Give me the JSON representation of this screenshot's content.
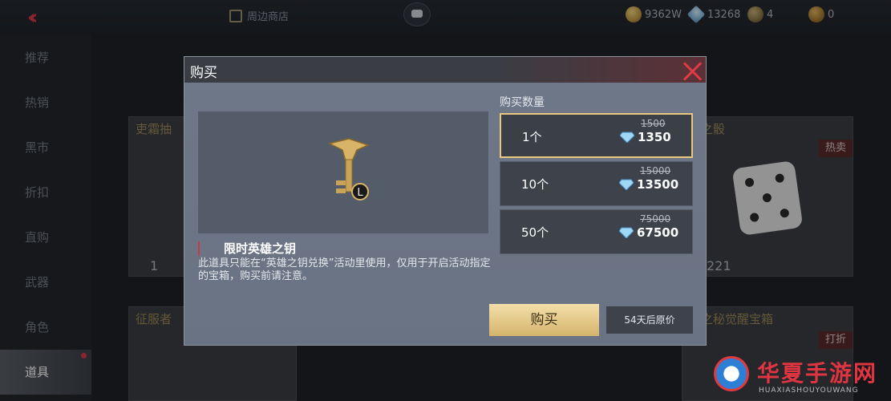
{
  "topbar": {
    "shop_link": "周边商店",
    "currencies": [
      {
        "icon": "gold-coin-icon",
        "value": "9362W"
      },
      {
        "icon": "diamond-icon",
        "value": "13268"
      },
      {
        "icon": "hero-token-icon",
        "value": "4"
      },
      {
        "icon": "key-coin-icon",
        "value": "0"
      }
    ]
  },
  "sidebar": {
    "items": [
      {
        "label": "推荐"
      },
      {
        "label": "热销"
      },
      {
        "label": "黑市"
      },
      {
        "label": "折扣"
      },
      {
        "label": "直购"
      },
      {
        "label": "武器"
      },
      {
        "label": "角色"
      },
      {
        "label": "道具"
      }
    ],
    "active_index": 7
  },
  "background_cards": [
    {
      "title": "吏霜抽",
      "count": "1"
    },
    {
      "title": "者之骰",
      "badge": "热卖",
      "count": "221"
    },
    {
      "title": "征服者",
      "count": ""
    },
    {
      "title": "霜之秘觉醒宝箱",
      "badge": "打折",
      "count": ""
    }
  ],
  "modal": {
    "title": "购买",
    "item_name": "限时英雄之钥",
    "item_desc": "此道具只能在“英雄之钥兑换”活动里使用，仅用于开启活动指定的宝箱，购买前请注意。",
    "quantity_label": "购买数量",
    "options": [
      {
        "count": "1个",
        "old_price": "1500",
        "price": "1350",
        "selected": true
      },
      {
        "count": "10个",
        "old_price": "15000",
        "price": "13500",
        "selected": false
      },
      {
        "count": "50个",
        "old_price": "75000",
        "price": "67500",
        "selected": false
      }
    ],
    "buy_label": "购买",
    "original_price_note": "54天后原价"
  },
  "watermark": {
    "text": "华夏手游网",
    "sub": "HUAXIASHOUYOUWANG"
  },
  "colors": {
    "accent_red": "#e03a44",
    "gold_button": "#d5b46c",
    "modal_bg": "#6f7888"
  }
}
